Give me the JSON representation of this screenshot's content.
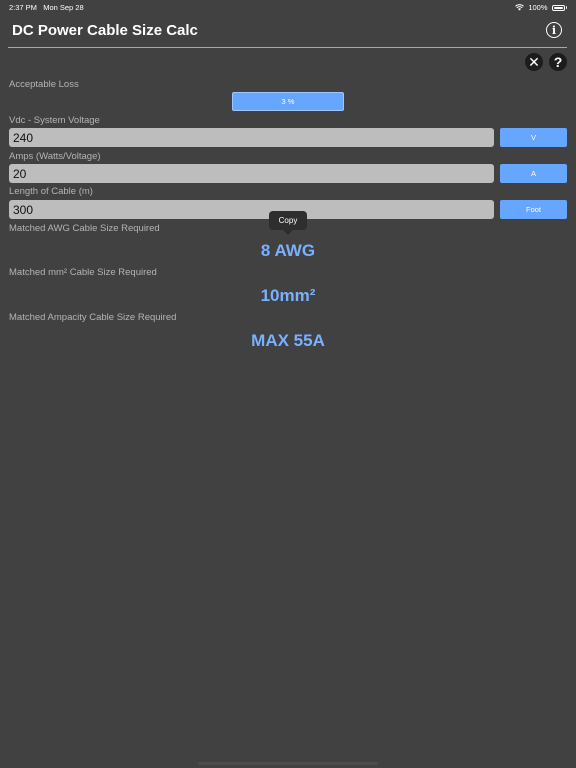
{
  "status_bar": {
    "time": "2:37 PM",
    "date": "Mon Sep 28",
    "battery": "100%"
  },
  "header": {
    "title": "DC Power Cable Size Calc"
  },
  "loss": {
    "label": "Acceptable Loss",
    "value": "3 %"
  },
  "voltage": {
    "label": "Vdc - System Voltage",
    "value": "240",
    "unit": "V"
  },
  "amps": {
    "label": "Amps (Watts/Voltage)",
    "value": "20",
    "unit": "A"
  },
  "length": {
    "label": "Length of Cable (m)",
    "value": "300",
    "unit": "Foot"
  },
  "tooltip": {
    "label": "Copy"
  },
  "results": {
    "awg_label": "Matched AWG Cable Size Required",
    "awg_value": "8 AWG",
    "mm2_label": "Matched mm² Cable Size Required",
    "mm2_value": "10mm²",
    "ampacity_label": "Matched Ampacity Cable Size Required",
    "ampacity_value": "MAX 55A"
  },
  "colors": {
    "background": "#414141",
    "accent": "#66a6ff",
    "result_text": "#79b0ff"
  }
}
